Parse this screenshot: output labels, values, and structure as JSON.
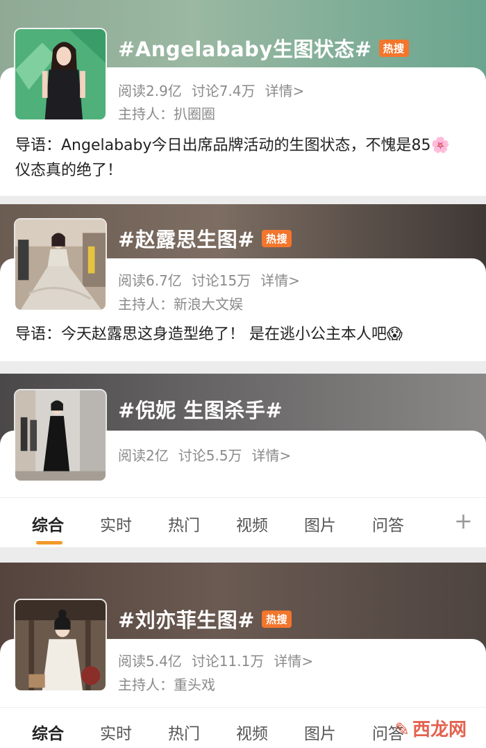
{
  "topics": [
    {
      "title": "#Angelababy生图状态#",
      "badge": "热搜",
      "reads": "阅读2.9亿",
      "discussions": "讨论7.4万",
      "details": "详情>",
      "host": "主持人：扒圈圈",
      "intro": "导语：Angelababy今日出席品牌活动的生图状态，不愧是85🌸仪态真的绝了！"
    },
    {
      "title": "#赵露思生图#",
      "badge": "热搜",
      "reads": "阅读6.7亿",
      "discussions": "讨论15万",
      "details": "详情>",
      "host": "主持人：新浪大文娱",
      "intro": "导语：今天赵露思这身造型绝了！ 是在逃小公主本人吧😱"
    },
    {
      "title": "#倪妮 生图杀手#",
      "reads": "阅读2亿",
      "discussions": "讨论5.5万",
      "details": "详情>"
    },
    {
      "title": "#刘亦菲生图#",
      "badge": "热搜",
      "reads": "阅读5.4亿",
      "discussions": "讨论11.1万",
      "details": "详情>",
      "host": "主持人：重头戏"
    }
  ],
  "tabs": [
    "综合",
    "实时",
    "热门",
    "视频",
    "图片",
    "问答"
  ],
  "tabs_plus": "+",
  "watermark": "西龙网",
  "colors": {
    "hot_badge": "#f3762c",
    "active_underline": "#f39a2b",
    "text_secondary": "#8a8a8a"
  }
}
